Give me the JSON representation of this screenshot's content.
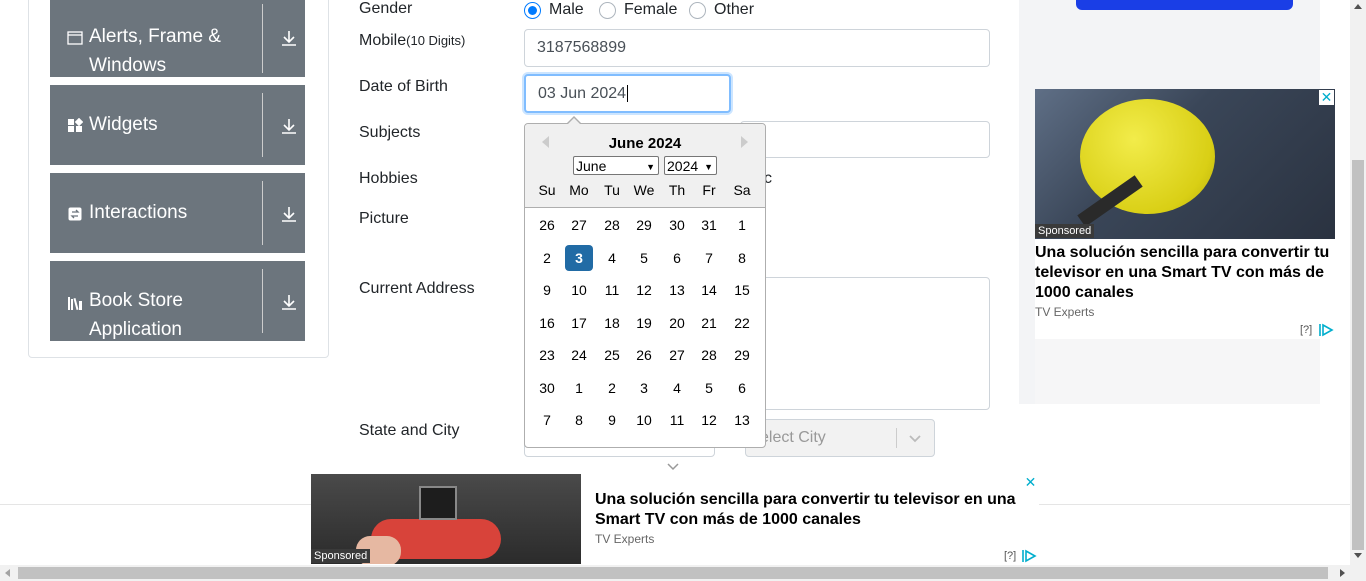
{
  "sidebar": {
    "groups": [
      {
        "label_line1": "Alerts, Frame &",
        "label_line2": "Windows",
        "icon": "window-icon"
      },
      {
        "label_line1": "Widgets",
        "icon": "widgets-icon"
      },
      {
        "label_line1": "Interactions",
        "icon": "interactions-icon"
      },
      {
        "label_line1": "Book Store",
        "label_line2": "Application",
        "icon": "book-icon"
      }
    ]
  },
  "form": {
    "gender_label": "Gender",
    "gender_options": [
      "Male",
      "Female",
      "Other"
    ],
    "gender_selected": "Male",
    "mobile_label": "Mobile",
    "mobile_hint": "(10 Digits)",
    "mobile_value": "3187568899",
    "dob_label": "Date of Birth",
    "dob_value": "03 Jun 2024",
    "subjects_label": "Subjects",
    "hobbies_label": "Hobbies",
    "hobbies_partial": "c",
    "picture_label": "Picture",
    "address_label": "Current Address",
    "state_city_label": "State and City",
    "city_placeholder": "elect City"
  },
  "datepicker": {
    "title": "June 2024",
    "month_select": "June",
    "year_select": "2024",
    "weekdays": [
      "Su",
      "Mo",
      "Tu",
      "We",
      "Th",
      "Fr",
      "Sa"
    ],
    "weeks": [
      [
        "26",
        "27",
        "28",
        "29",
        "30",
        "31",
        "1"
      ],
      [
        "2",
        "3",
        "4",
        "5",
        "6",
        "7",
        "8"
      ],
      [
        "9",
        "10",
        "11",
        "12",
        "13",
        "14",
        "15"
      ],
      [
        "16",
        "17",
        "18",
        "19",
        "20",
        "21",
        "22"
      ],
      [
        "23",
        "24",
        "25",
        "26",
        "27",
        "28",
        "29"
      ],
      [
        "30",
        "1",
        "2",
        "3",
        "4",
        "5",
        "6"
      ],
      [
        "7",
        "8",
        "9",
        "10",
        "11",
        "12",
        "13"
      ]
    ],
    "selected_day": "3"
  },
  "ad_right": {
    "sponsored": "Sponsored",
    "title": "Una solución sencilla para convertir tu televisor en una Smart TV con más de 1000 canales",
    "source": "TV Experts",
    "help": "[?]",
    "close": "✕"
  },
  "ad_bottom": {
    "sponsored": "Sponsored",
    "title": "Una solución sencilla para convertir tu televisor en una Smart TV con más de 1000 canales",
    "source": "TV Experts",
    "help": "[?]",
    "close": "✕"
  },
  "colors": {
    "primary": "#007bff",
    "sidebar_group": "#6c757d",
    "selected_day": "#216ba5",
    "ad_accent": "#00aecd"
  }
}
